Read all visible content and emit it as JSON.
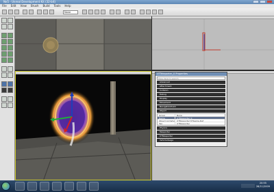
{
  "window": {
    "title": "Ne5 - Unreal Development Kit (32-bit)"
  },
  "menu": [
    "File",
    "Edit",
    "View",
    "Brush",
    "Build",
    "Tools",
    "Help"
  ],
  "toolbar": {
    "select_value": "None"
  },
  "properties": {
    "title": "UTTeleporter_0 Properties",
    "search_placeholder": "Type here to search",
    "categories_top": [
      "Advanced",
      "Attachment",
      "Collision",
      "Debug",
      "Display",
      "Movement",
      "NavigationPoint",
      "Object"
    ],
    "grid": [
      {
        "key": "Group",
        "value": "None",
        "highlight": false
      },
      {
        "key": "Name",
        "value": "UTTeleporter_0",
        "highlight": true
      },
      {
        "key": "Object Archetype",
        "value": "UTTeleporter'UTGame.Def",
        "highlight": false
      },
      {
        "key": "Tag",
        "value": "UTTeleporter",
        "highlight": false
      }
    ],
    "categories_bottom": [
      "Physics",
      "Teleporter",
      "UTTeleporter",
      "VehicleUsage"
    ]
  },
  "clock": {
    "time": "20:55",
    "date": "28/11/2009"
  },
  "colors": {
    "selected_viewport_border": "#d4cf2e",
    "portal_glow": "#f3a23b",
    "portal_core": "#5b2fa8"
  }
}
